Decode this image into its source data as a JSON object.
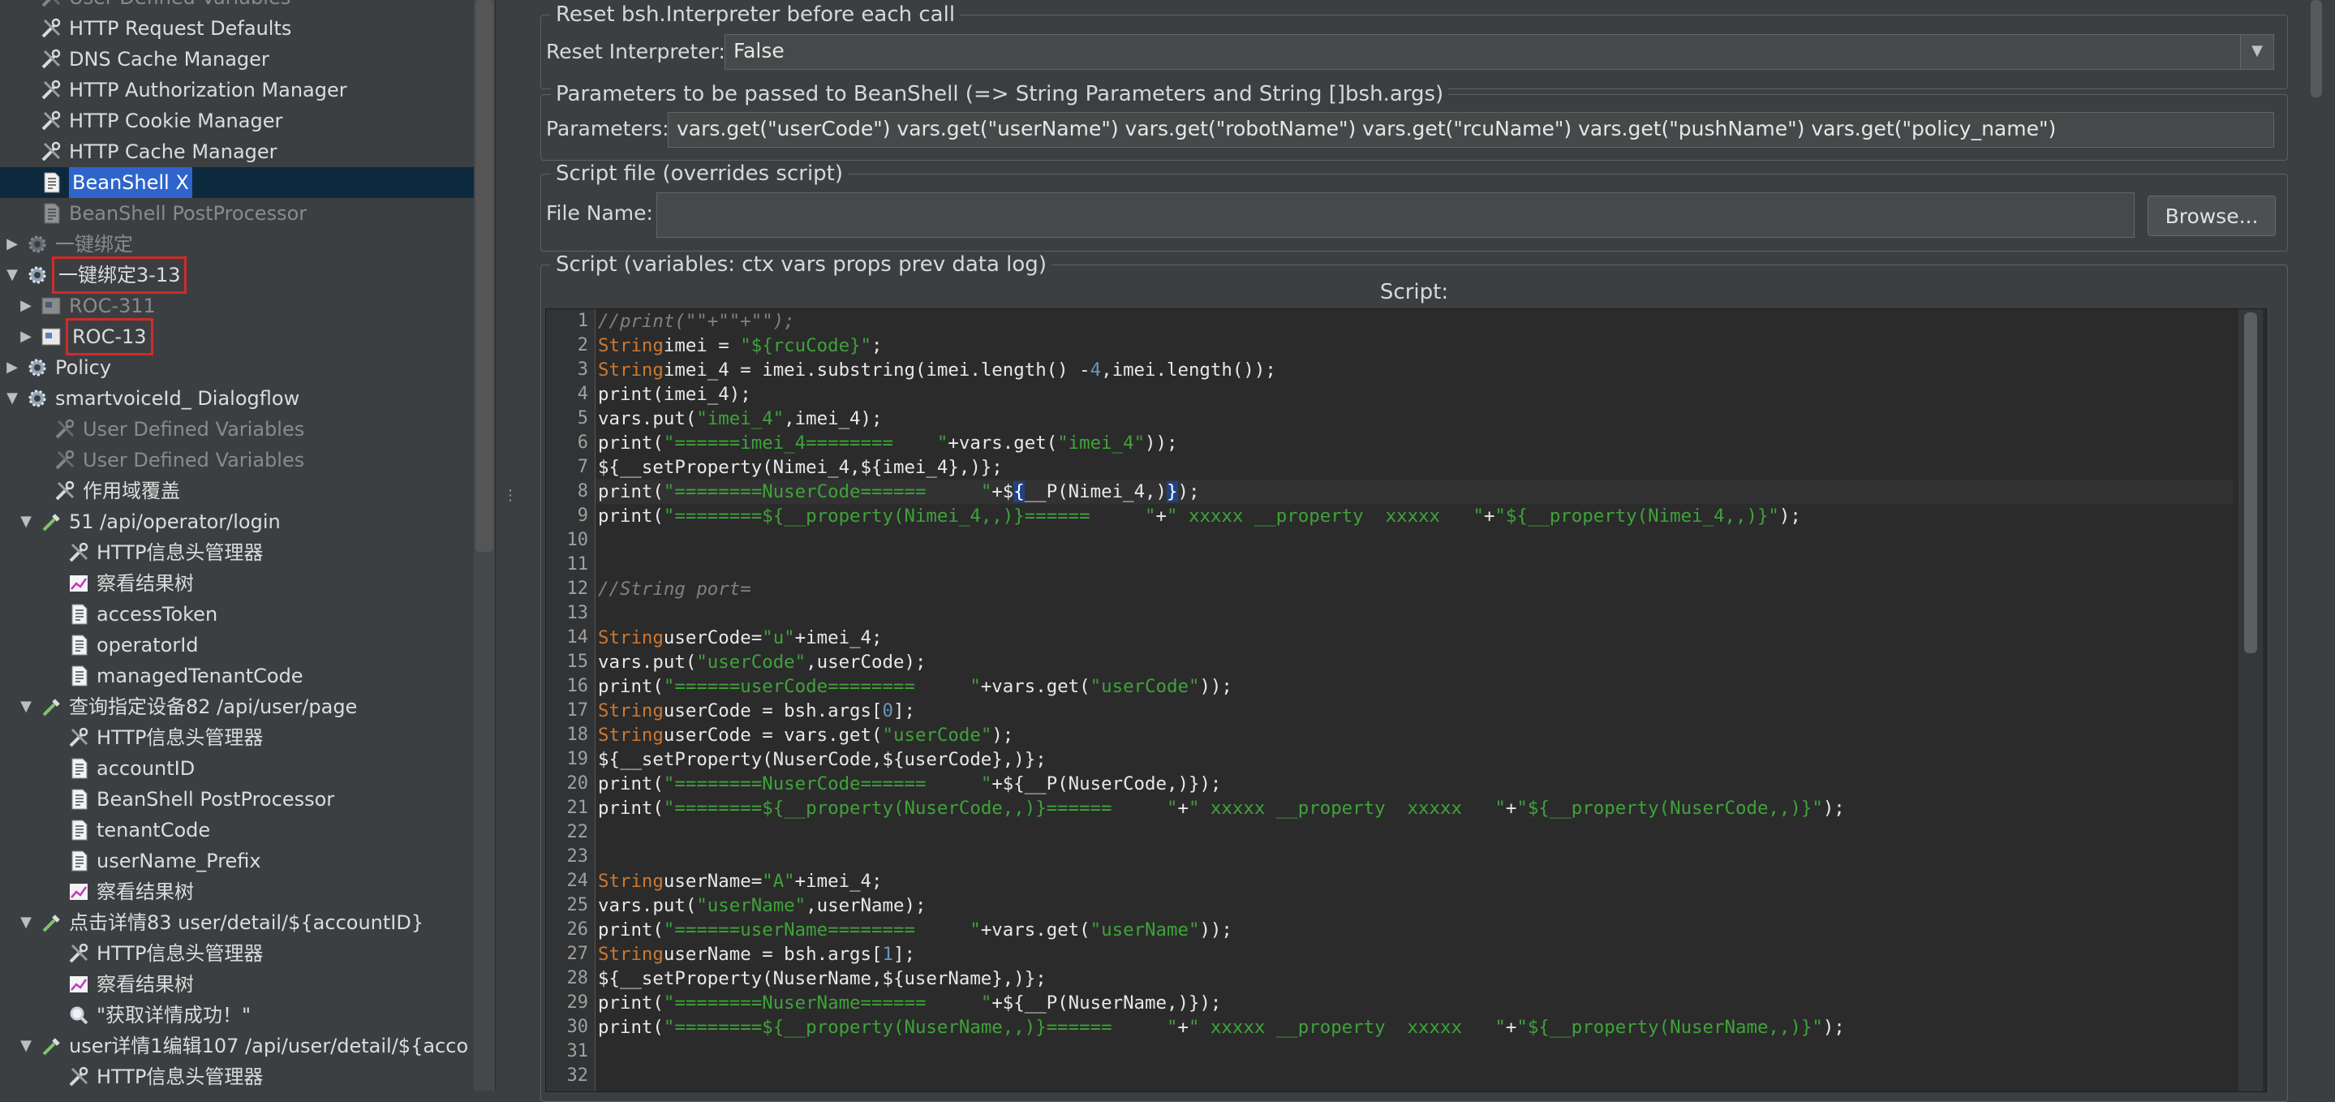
{
  "tree": {
    "items": [
      {
        "label": "User Defined Variables",
        "icon": "wrench-icon",
        "indent": 1,
        "arrow": "",
        "state": "disabled"
      },
      {
        "label": "HTTP Request Defaults",
        "icon": "wrench-icon",
        "indent": 1,
        "arrow": "",
        "state": ""
      },
      {
        "label": "DNS Cache Manager",
        "icon": "wrench-icon",
        "indent": 1,
        "arrow": "",
        "state": ""
      },
      {
        "label": "HTTP Authorization Manager",
        "icon": "wrench-icon",
        "indent": 1,
        "arrow": "",
        "state": ""
      },
      {
        "label": "HTTP Cookie Manager",
        "icon": "wrench-icon",
        "indent": 1,
        "arrow": "",
        "state": ""
      },
      {
        "label": "HTTP Cache Manager",
        "icon": "wrench-icon",
        "indent": 1,
        "arrow": "",
        "state": ""
      },
      {
        "label": "BeanShell X",
        "icon": "script-icon",
        "indent": 1,
        "arrow": "",
        "state": "selected"
      },
      {
        "label": "BeanShell PostProcessor",
        "icon": "script-icon",
        "indent": 1,
        "arrow": "",
        "state": "disabled"
      },
      {
        "label": "一键绑定",
        "icon": "gear-icon",
        "indent": 0,
        "arrow": "collapsed",
        "state": "disabled"
      },
      {
        "label": "一键绑定3-13",
        "icon": "gear-icon",
        "indent": 0,
        "arrow": "expanded",
        "state": "boxed"
      },
      {
        "label": "ROC-311",
        "icon": "module-icon",
        "indent": 1,
        "arrow": "collapsed",
        "state": "disabled"
      },
      {
        "label": "ROC-13",
        "icon": "module-icon",
        "indent": 1,
        "arrow": "collapsed",
        "state": "boxed"
      },
      {
        "label": "Policy",
        "icon": "gear-icon",
        "indent": 0,
        "arrow": "collapsed",
        "state": ""
      },
      {
        "label": "smartvoiceId_ Dialogflow",
        "icon": "gear-icon",
        "indent": 0,
        "arrow": "expanded",
        "state": ""
      },
      {
        "label": "User Defined Variables",
        "icon": "wrench-icon",
        "indent": 2,
        "arrow": "",
        "state": "disabled"
      },
      {
        "label": "User Defined Variables",
        "icon": "wrench-icon",
        "indent": 2,
        "arrow": "",
        "state": "disabled"
      },
      {
        "label": "作用域覆盖",
        "icon": "wrench-icon",
        "indent": 2,
        "arrow": "",
        "state": ""
      },
      {
        "label": "51 /api/operator/login",
        "icon": "pipette-icon",
        "indent": 1,
        "arrow": "expanded",
        "state": ""
      },
      {
        "label": "HTTP信息头管理器",
        "icon": "wrench-icon",
        "indent": 3,
        "arrow": "",
        "state": ""
      },
      {
        "label": "察看结果树",
        "icon": "graph-icon",
        "indent": 3,
        "arrow": "",
        "state": ""
      },
      {
        "label": "accessToken",
        "icon": "script-icon",
        "indent": 3,
        "arrow": "",
        "state": ""
      },
      {
        "label": "operatorId",
        "icon": "script-icon",
        "indent": 3,
        "arrow": "",
        "state": ""
      },
      {
        "label": "managedTenantCode",
        "icon": "script-icon",
        "indent": 3,
        "arrow": "",
        "state": ""
      },
      {
        "label": "查询指定设备82 /api/user/page",
        "icon": "pipette-icon",
        "indent": 1,
        "arrow": "expanded",
        "state": ""
      },
      {
        "label": "HTTP信息头管理器",
        "icon": "wrench-icon",
        "indent": 3,
        "arrow": "",
        "state": ""
      },
      {
        "label": "accountID",
        "icon": "script-icon",
        "indent": 3,
        "arrow": "",
        "state": ""
      },
      {
        "label": "BeanShell PostProcessor",
        "icon": "script-icon",
        "indent": 3,
        "arrow": "",
        "state": ""
      },
      {
        "label": "tenantCode",
        "icon": "script-icon",
        "indent": 3,
        "arrow": "",
        "state": ""
      },
      {
        "label": "userName_Prefix",
        "icon": "script-icon",
        "indent": 3,
        "arrow": "",
        "state": ""
      },
      {
        "label": "察看结果树",
        "icon": "graph-icon",
        "indent": 3,
        "arrow": "",
        "state": ""
      },
      {
        "label": "点击详情83 user/detail/${accountID}",
        "icon": "pipette-icon",
        "indent": 1,
        "arrow": "expanded",
        "state": ""
      },
      {
        "label": "HTTP信息头管理器",
        "icon": "wrench-icon",
        "indent": 3,
        "arrow": "",
        "state": ""
      },
      {
        "label": "察看结果树",
        "icon": "graph-icon",
        "indent": 3,
        "arrow": "",
        "state": ""
      },
      {
        "label": "\"获取详情成功！\"",
        "icon": "magnifier-icon",
        "indent": 3,
        "arrow": "",
        "state": ""
      },
      {
        "label": "user详情1编辑107 /api/user/detail/${acco",
        "icon": "pipette-icon",
        "indent": 1,
        "arrow": "expanded",
        "state": ""
      },
      {
        "label": "HTTP信息头管理器",
        "icon": "wrench-icon",
        "indent": 3,
        "arrow": "",
        "state": ""
      }
    ]
  },
  "reset_group": {
    "title": "Reset bsh.Interpreter before each call",
    "label": "Reset Interpreter:",
    "value": "False"
  },
  "params_group": {
    "title": "Parameters to be passed to BeanShell (=> String Parameters and String []bsh.args)",
    "label": "Parameters:",
    "value": "vars.get(\"userCode\") vars.get(\"userName\") vars.get(\"robotName\") vars.get(\"rcuName\") vars.get(\"pushName\") vars.get(\"policy_name\")"
  },
  "file_group": {
    "title": "Script file (overrides script)",
    "label": "File Name:",
    "value": "",
    "browse_label": "Browse..."
  },
  "script_group": {
    "title": "Script (variables: ctx vars props prev data log)",
    "editor_label": "Script:",
    "highlighted_line": 8,
    "lines": [
      [
        [
          "cm",
          "//print(\"\"+\"\"+\"\");"
        ]
      ],
      [
        [
          "kw",
          "String"
        ],
        [
          "",
          "imei = "
        ],
        [
          "str",
          "\"${rcuCode}\""
        ],
        [
          "",
          ";"
        ]
      ],
      [
        [
          "kw",
          "String"
        ],
        [
          "",
          "imei_4 = imei.substring(imei.length() -"
        ],
        [
          "num",
          "4"
        ],
        [
          "",
          ",imei.length());"
        ]
      ],
      [
        [
          "",
          "print(imei_4);"
        ]
      ],
      [
        [
          "",
          "vars.put("
        ],
        [
          "str",
          "\"imei_4\""
        ],
        [
          "",
          ",imei_4);"
        ]
      ],
      [
        [
          "",
          "print("
        ],
        [
          "str",
          "\"======imei_4========    \""
        ],
        [
          "",
          "+vars.get("
        ],
        [
          "str",
          "\"imei_4\""
        ],
        [
          "",
          "));"
        ]
      ],
      [
        [
          "",
          "${__setProperty(Nimei_4,${imei_4},)};"
        ]
      ],
      [
        [
          "",
          "print("
        ],
        [
          "str",
          "\"========NuserCode======     \""
        ],
        [
          "",
          "+$"
        ],
        [
          "br",
          "{"
        ],
        [
          "",
          "__P(Nimei_4,)"
        ],
        [
          "br",
          "}"
        ],
        [
          "",
          ");"
        ]
      ],
      [
        [
          "",
          "print("
        ],
        [
          "str",
          "\"========${__property(Nimei_4,,)}======     \""
        ],
        [
          "",
          "+"
        ],
        [
          "str",
          "\" xxxxx __property  xxxxx   \""
        ],
        [
          "",
          "+"
        ],
        [
          "str",
          "\"${__property(Nimei_4,,)}\""
        ],
        [
          "",
          ");"
        ]
      ],
      [
        [
          "",
          ""
        ]
      ],
      [
        [
          "",
          ""
        ]
      ],
      [
        [
          "cm",
          "//String port="
        ]
      ],
      [
        [
          "",
          ""
        ]
      ],
      [
        [
          "kw",
          "String"
        ],
        [
          "",
          "userCode="
        ],
        [
          "str",
          "\"u\""
        ],
        [
          "",
          "+imei_4;"
        ]
      ],
      [
        [
          "",
          "vars.put("
        ],
        [
          "str",
          "\"userCode\""
        ],
        [
          "",
          ",userCode);"
        ]
      ],
      [
        [
          "",
          "print("
        ],
        [
          "str",
          "\"======userCode========     \""
        ],
        [
          "",
          "+vars.get("
        ],
        [
          "str",
          "\"userCode\""
        ],
        [
          "",
          "));"
        ]
      ],
      [
        [
          "kw",
          "String"
        ],
        [
          "",
          "userCode = bsh.args["
        ],
        [
          "num",
          "0"
        ],
        [
          "",
          "];"
        ]
      ],
      [
        [
          "kw",
          "String"
        ],
        [
          "",
          "userCode = vars.get("
        ],
        [
          "str",
          "\"userCode\""
        ],
        [
          "",
          ");"
        ]
      ],
      [
        [
          "",
          "${__setProperty(NuserCode,${userCode},)};"
        ]
      ],
      [
        [
          "",
          "print("
        ],
        [
          "str",
          "\"========NuserCode======     \""
        ],
        [
          "",
          "+${__P(NuserCode,)});"
        ]
      ],
      [
        [
          "",
          "print("
        ],
        [
          "str",
          "\"========${__property(NuserCode,,)}======     \""
        ],
        [
          "",
          "+"
        ],
        [
          "str",
          "\" xxxxx __property  xxxxx   \""
        ],
        [
          "",
          "+"
        ],
        [
          "str",
          "\"${__property(NuserCode,,)}\""
        ],
        [
          "",
          ");"
        ]
      ],
      [
        [
          "",
          ""
        ]
      ],
      [
        [
          "",
          ""
        ]
      ],
      [
        [
          "kw",
          "String"
        ],
        [
          "",
          "userName="
        ],
        [
          "str",
          "\"A\""
        ],
        [
          "",
          "+imei_4;"
        ]
      ],
      [
        [
          "",
          "vars.put("
        ],
        [
          "str",
          "\"userName\""
        ],
        [
          "",
          ",userName);"
        ]
      ],
      [
        [
          "",
          "print("
        ],
        [
          "str",
          "\"======userName========     \""
        ],
        [
          "",
          "+vars.get("
        ],
        [
          "str",
          "\"userName\""
        ],
        [
          "",
          "));"
        ]
      ],
      [
        [
          "kw",
          "String"
        ],
        [
          "",
          "userName = bsh.args["
        ],
        [
          "num",
          "1"
        ],
        [
          "",
          "];"
        ]
      ],
      [
        [
          "",
          "${__setProperty(NuserName,${userName},)};"
        ]
      ],
      [
        [
          "",
          "print("
        ],
        [
          "str",
          "\"========NuserName======     \""
        ],
        [
          "",
          "+${__P(NuserName,)});"
        ]
      ],
      [
        [
          "",
          "print("
        ],
        [
          "str",
          "\"========${__property(NuserName,,)}======     \""
        ],
        [
          "",
          "+"
        ],
        [
          "str",
          "\" xxxxx __property  xxxxx   \""
        ],
        [
          "",
          "+"
        ],
        [
          "str",
          "\"${__property(NuserName,,)}\""
        ],
        [
          "",
          ");"
        ]
      ],
      [
        [
          "",
          ""
        ]
      ],
      [
        [
          "",
          ""
        ]
      ]
    ]
  }
}
